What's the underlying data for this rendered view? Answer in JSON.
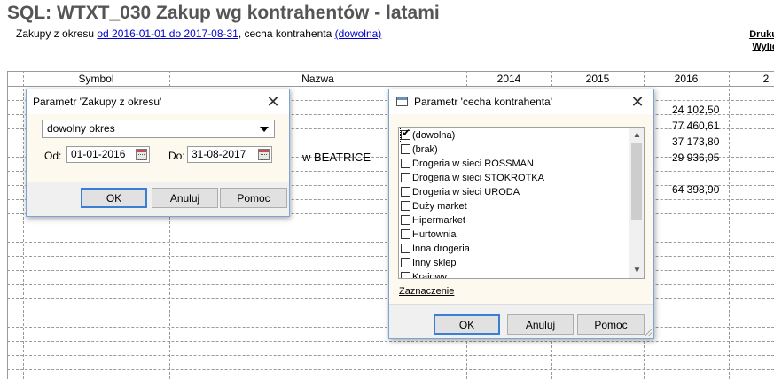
{
  "report": {
    "title": "SQL: WTXT_030 Zakup wg kontrahentów - latami",
    "subtitle_prefix": "Zakupy z okresu ",
    "period_link": "od 2016-01-01 do 2017-08-31",
    "subtitle_middle": ", cecha kontrahenta ",
    "feature_link": "(dowolna)",
    "print_link": "Druku",
    "calc_link": "Wylic"
  },
  "table": {
    "headers": {
      "symbol": "Symbol",
      "name": "Nazwa",
      "y2014": "2014",
      "y2015": "2015",
      "y2016": "2016",
      "y2017": "2"
    },
    "visible_fragment": "w BEATRICE",
    "values_2016": [
      "24 102,50",
      "77 460,61",
      "37 173,80",
      "29 936,05",
      "64 398,90"
    ]
  },
  "period_dialog": {
    "title": "Parametr 'Zakupy z okresu'",
    "period_select": "dowolny okres",
    "from_label": "Od:",
    "from_value": "01-01-2016",
    "to_label": "Do:",
    "to_value": "31-08-2017",
    "ok": "OK",
    "cancel": "Anuluj",
    "help": "Pomoc"
  },
  "feature_dialog": {
    "title": "Parametr 'cecha kontrahenta'",
    "items": [
      {
        "label": "(dowolna)",
        "checked": true
      },
      {
        "label": "(brak)",
        "checked": false
      },
      {
        "label": "Drogeria w sieci ROSSMAN",
        "checked": false
      },
      {
        "label": "Drogeria w sieci STOKROTKA",
        "checked": false
      },
      {
        "label": "Drogeria w sieci URODA",
        "checked": false
      },
      {
        "label": "Duży market",
        "checked": false
      },
      {
        "label": "Hipermarket",
        "checked": false
      },
      {
        "label": "Hurtownia",
        "checked": false
      },
      {
        "label": "Inna drogeria",
        "checked": false
      },
      {
        "label": "Inny sklep",
        "checked": false
      },
      {
        "label": "Krajowy",
        "checked": false
      }
    ],
    "selection_link": "Zaznaczenie",
    "ok": "OK",
    "cancel": "Anuluj",
    "help": "Pomoc"
  },
  "icons": {
    "close": "close-icon",
    "dropdown": "chevron-down-icon",
    "calendar": "calendar-icon",
    "checkmark": "checkmark-icon",
    "window": "window-icon"
  },
  "colors": {
    "title": "#555555",
    "link": "#0000cc",
    "dialog_border": "#7aa5d6",
    "dialog_body": "#fdf9ef"
  }
}
